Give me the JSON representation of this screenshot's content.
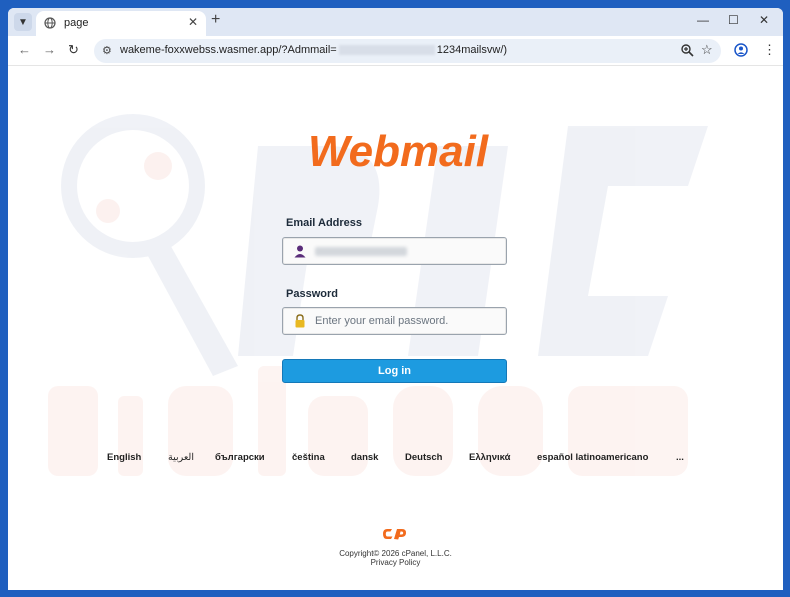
{
  "browser": {
    "tab_title": "page",
    "new_tab": "+",
    "url_prefix": "wakeme-foxxwebss.wasmer.app/?Admmail=",
    "url_suffix": "1234mailsvw/)"
  },
  "brand": {
    "logo_text": "Webmail",
    "accent_color": "#f26b1d",
    "button_color": "#1d9be0"
  },
  "form": {
    "email_label": "Email Address",
    "password_label": "Password",
    "password_placeholder": "Enter your email password.",
    "login_label": "Log in"
  },
  "languages": [
    "English",
    "العربية",
    "български",
    "čeština",
    "dansk",
    "Deutsch",
    "Ελληνικά",
    "español latinoamericano",
    "..."
  ],
  "footer": {
    "copyright": "Copyright© 2026 cPanel, L.L.C.",
    "privacy": "Privacy Policy"
  },
  "watermark_text": "PC risk.com"
}
